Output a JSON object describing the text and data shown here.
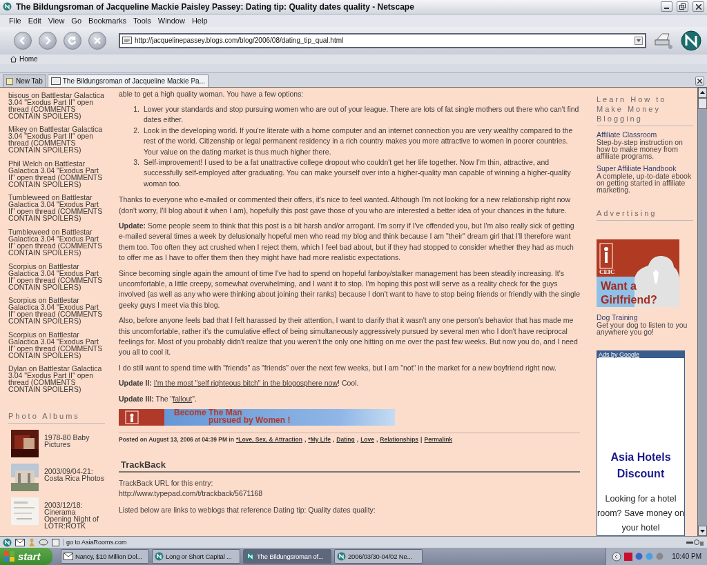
{
  "window": {
    "title": "The Bildungsroman of Jacqueline Mackie Paisley Passey: Dating tip: Quality dates quality - Netscape"
  },
  "menu": [
    "File",
    "Edit",
    "View",
    "Go",
    "Bookmarks",
    "Tools",
    "Window",
    "Help"
  ],
  "address": {
    "url": "http://jacquelinepassey.blogs.com/blog/2006/08/dating_tip_qual.html"
  },
  "personal_toolbar": [
    "Home"
  ],
  "tabs": [
    {
      "label": "New Tab",
      "kind": "new"
    },
    {
      "label": "The Bildungsroman of Jacqueline Mackie Pa...",
      "kind": "page",
      "selected": true
    }
  ],
  "sidebar": {
    "recent_comments": [
      {
        "text": "bisous on Battlestar Galactica 3.04 \"Exodus Part II\" open thread (COMMENTS CONTAIN SPOILERS)"
      },
      {
        "text": "Mikey on Battlestar Galactica 3.04 \"Exodus Part II\" open thread (COMMENTS CONTAIN SPOILERS)"
      },
      {
        "text": "Phil Welch on Battlestar Galactica 3.04 \"Exodus Part II\" open thread (COMMENTS CONTAIN SPOILERS)"
      },
      {
        "text": "Tumbleweed on Battlestar Galactica 3.04 \"Exodus Part II\" open thread (COMMENTS CONTAIN SPOILERS)"
      },
      {
        "text": "Tumbleweed on Battlestar Galactica 3.04 \"Exodus Part II\" open thread (COMMENTS CONTAIN SPOILERS)"
      },
      {
        "text": "Scorpius on Battlestar Galactica 3.04 \"Exodus Part II\" open thread (COMMENTS CONTAIN SPOILERS)"
      },
      {
        "text": "Scorpius on Battlestar Galactica 3.04 \"Exodus Part II\" open thread (COMMENTS CONTAIN SPOILERS)"
      },
      {
        "text": "Scorpius on Battlestar Galactica 3.04 \"Exodus Part II\" open thread (COMMENTS CONTAIN SPOILERS)"
      },
      {
        "text": "Dylan on Battlestar Galactica 3.04 \"Exodus Part II\" open thread (COMMENTS CONTAIN SPOILERS)"
      }
    ],
    "photo_albums": {
      "title": "Photo Albums",
      "items": [
        {
          "caption": "1978-80 Baby Pictures",
          "kind": "picture"
        },
        {
          "caption": "2003/09/04-21: Costa Rica Photos",
          "kind": "picture"
        },
        {
          "caption": "2003/12/18: Cinerama Opening Night of LOTR:ROTK",
          "kind": "picture"
        }
      ]
    }
  },
  "post": {
    "intro": "able to get a high quality woman. You have a few options:",
    "options": [
      {
        "number": "1.",
        "text": "Lower your standards and stop pursuing women who are out of your league. There are lots of fat single mothers out there who can't find dates either."
      },
      {
        "number": "2.",
        "text": "Look in the developing world. If you're literate with a home computer and an internet connection you are very wealthy compared to the rest of the world. Citizenship or legal permanent residency in a rich country makes you more attractive to women in poorer countries. Your value on the dating market is thus much higher there."
      },
      {
        "number": "3.",
        "text": "Self-improvement! I used to be a fat unattractive college dropout who couldn't get her life together. Now I'm thin, attractive, and successfully self-employed after graduating. You can make yourself over into a higher-quality man capable of winning a higher-quality woman too."
      }
    ],
    "paragraphs": [
      {
        "segments": [
          {
            "kind": "text",
            "text": "Thanks to everyone who e-mailed or commented their offers, it's nice to feel wanted.  Although I'm not looking for a new relationship right now (don't worry, I'll blog about it when I am), hopefully this post gave those of you who are interested a better idea of your chances in the future."
          }
        ]
      },
      {
        "segments": [
          {
            "kind": "bold",
            "text": "Update:"
          },
          {
            "kind": "text",
            "text": " Some people seem to think that this post is a bit harsh and/or arrogant.  I'm sorry if I've offended you, but I'm also really sick of getting e-mailed several times a week by delusionally hopeful men who read my blog and think because I am \"their\" dream girl that I'll therefore want them too.  Too often they act crushed when I reject them, which I feel bad about, but if they had stopped to consider whether they had as much to offer me as I have to offer them then they might have had more realistic expectations."
          }
        ]
      },
      {
        "segments": [
          {
            "kind": "text",
            "text": "Since becoming single again the amount of time I've had to spend on hopeful fanboy/stalker management has been steadily increasing.  It's uncomfortable, a little creepy, somewhat overwhelming, and I want it to stop.  I'm hoping this post will serve as a reality check for the guys involved (as well as any who were thinking about joining their ranks) because I don't want to have to stop being friends or friendly with the single geeky guys I meet via this blog."
          }
        ]
      },
      {
        "segments": [
          {
            "kind": "text",
            "text": "Also, before anyone feels bad that I felt harassed by their attention, I want to clarify that it wasn't any one person's behavior that has made me this uncomfortable, rather it's the cumulative effect of being simultaneously aggressively pursued by several men who I don't have reciprocal feelings for.  Most of you probably didn't realize that you weren't the only one hitting on me over the past few weeks.  But now you do, and I need you all to cool it."
          }
        ]
      },
      {
        "segments": [
          {
            "kind": "text",
            "text": "I do still want to spend time with \"friends\" as \"friends\" over the next few weeks, but I am \"not\" in the market for a new boyfriend right now."
          }
        ]
      },
      {
        "segments": [
          {
            "kind": "bold",
            "text": "Update II: "
          },
          {
            "kind": "link",
            "text": "I'm the most \"self righteous bitch\" in the blogosphere now"
          },
          {
            "kind": "text",
            "text": "!  Cool."
          }
        ]
      },
      {
        "segments": [
          {
            "kind": "bold",
            "text": "Update III:"
          },
          {
            "kind": "text",
            "text": " The \""
          },
          {
            "kind": "link",
            "text": "fallout"
          },
          {
            "kind": "text",
            "text": "\"."
          }
        ]
      }
    ],
    "banner": {
      "line_1": "Become The Man",
      "line_2": "pursued by Women !"
    },
    "footer": {
      "posted": "Posted on August 13, 2006 at 04:39 PM in",
      "categories": [
        "*Love, Sex, & Attraction",
        "*My Life",
        "Dating",
        "Love",
        "Relationships"
      ],
      "separator": ",",
      "divider": "|",
      "permalink": "Permalink"
    },
    "trackback": {
      "title": "TrackBack",
      "label": "TrackBack URL for this entry:",
      "url": "http://www.typepad.com/t/trackback/5671168",
      "listed": "Listed below are links to weblogs that reference Dating tip: Quality dates quality:"
    }
  },
  "right_sidebar": {
    "money_title": "Learn How to Make Money Blogging",
    "money_links": [
      {
        "title": "Affiliate Classroom",
        "description": "Step-by-step instruction on how to make money from affiliate programs."
      },
      {
        "title": "Super Affiliate Handbook",
        "description": "A complete, up-to-date ebook on getting started in affiliate marketing."
      }
    ],
    "advertising_title": "Advertising",
    "ad": {
      "badge": "CEIC",
      "headline": "Want a Girlfriend?",
      "title": "Dog Training",
      "description": "Get your dog to listen to you anywhere you go!"
    },
    "google_ad": {
      "label": "Ads by Google",
      "title": "Asia Hotels Discount",
      "text": "Looking for a hotel room? Save money on your hotel"
    }
  },
  "status_bar": {
    "text": "go to AsiaRooms.com"
  },
  "taskbar": {
    "start": "start",
    "tasks": [
      {
        "label": "Nancy, $10 Million Dol...",
        "kind": "mail",
        "selected": false
      },
      {
        "label": "Long or Short Capital ...",
        "kind": "browser",
        "selected": false
      },
      {
        "label": "The Bildungsroman of...",
        "kind": "browser",
        "selected": true
      },
      {
        "label": "2006/03/30-04/02 Ne...",
        "kind": "browser",
        "selected": false
      }
    ],
    "clock": "10:40 PM"
  }
}
